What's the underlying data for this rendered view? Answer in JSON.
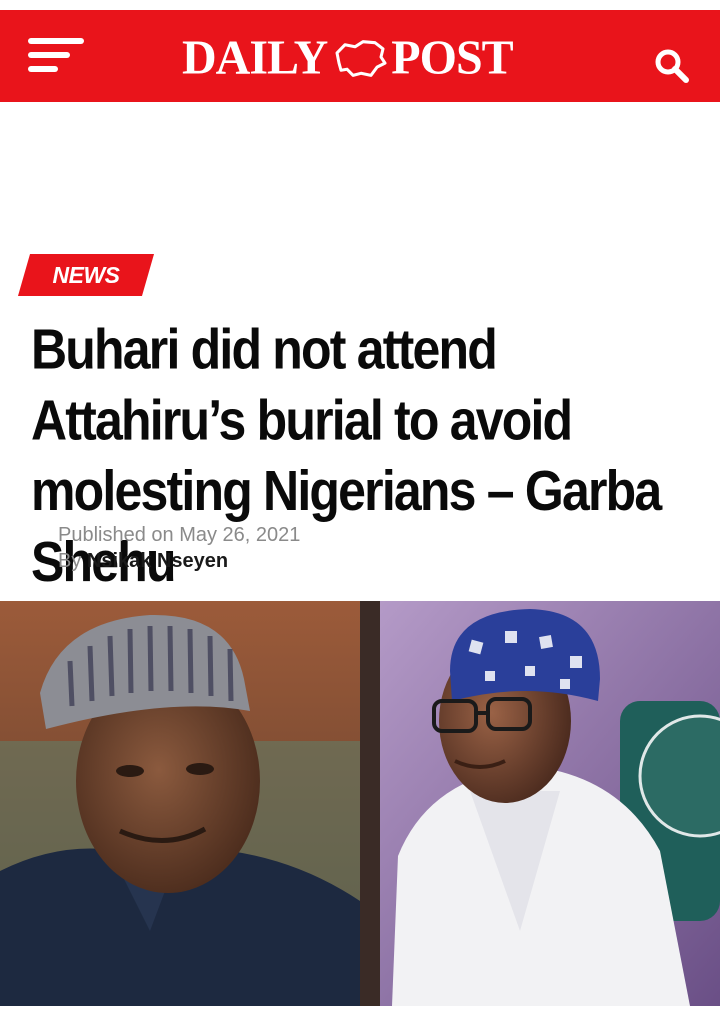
{
  "header": {
    "logo_left": "DAILY",
    "logo_right": "POST",
    "menu_icon": "hamburger-menu-icon",
    "search_icon": "search-icon",
    "brand_color": "#e9141b"
  },
  "article": {
    "category": "NEWS",
    "headline": "Buhari did not attend Attahiru’s burial to avoid molesting Nigerians – Garba Shehu",
    "published_prefix": "Published on",
    "published_date": "May 26, 2021",
    "by_prefix": "By",
    "author": "Nsikak Nseyen"
  }
}
